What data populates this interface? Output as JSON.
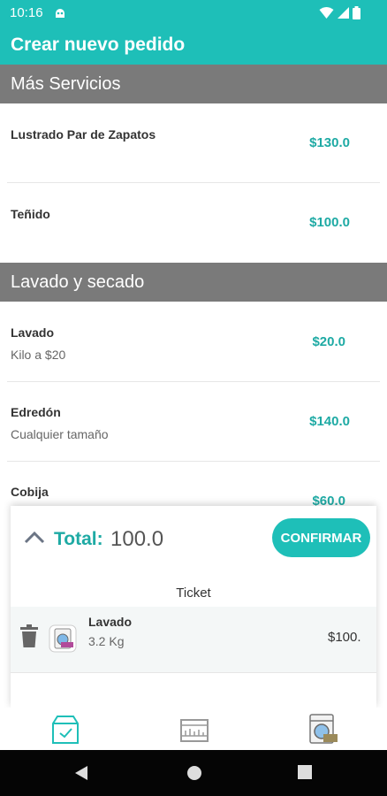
{
  "status_bar": {
    "time": "10:16"
  },
  "app_bar": {
    "title": "Crear nuevo pedido"
  },
  "sections": [
    {
      "title": "Más Servicios",
      "items": [
        {
          "name": "Lustrado Par de Zapatos",
          "desc": "",
          "price": "$130.0"
        },
        {
          "name": "Teñido",
          "desc": "",
          "price": "$100.0"
        }
      ]
    },
    {
      "title": "Lavado y secado",
      "items": [
        {
          "name": "Lavado",
          "desc": "Kilo a $20",
          "price": "$20.0"
        },
        {
          "name": "Edredón",
          "desc": "Cualquier tamaño",
          "price": "$140.0"
        },
        {
          "name": "Cobija",
          "desc": "",
          "price": "$60.0"
        }
      ]
    }
  ],
  "order_sheet": {
    "total_label": "Total:",
    "total_value": "100.0",
    "confirm_label": "CONFIRMAR",
    "ticket_title": "Ticket",
    "ticket_items": [
      {
        "name": "Lavado",
        "qty": "3.2 Kg",
        "price": "$100."
      }
    ]
  },
  "bottom_nav": {
    "tabs": [
      {
        "icon": "package-check-icon",
        "active": true
      },
      {
        "icon": "storefront-icon",
        "active": false
      },
      {
        "icon": "washing-machine-icon",
        "active": false
      }
    ]
  },
  "colors": {
    "primary": "#1ebfb8",
    "section_header": "#7a7a7a",
    "price": "#1eaaa4"
  }
}
